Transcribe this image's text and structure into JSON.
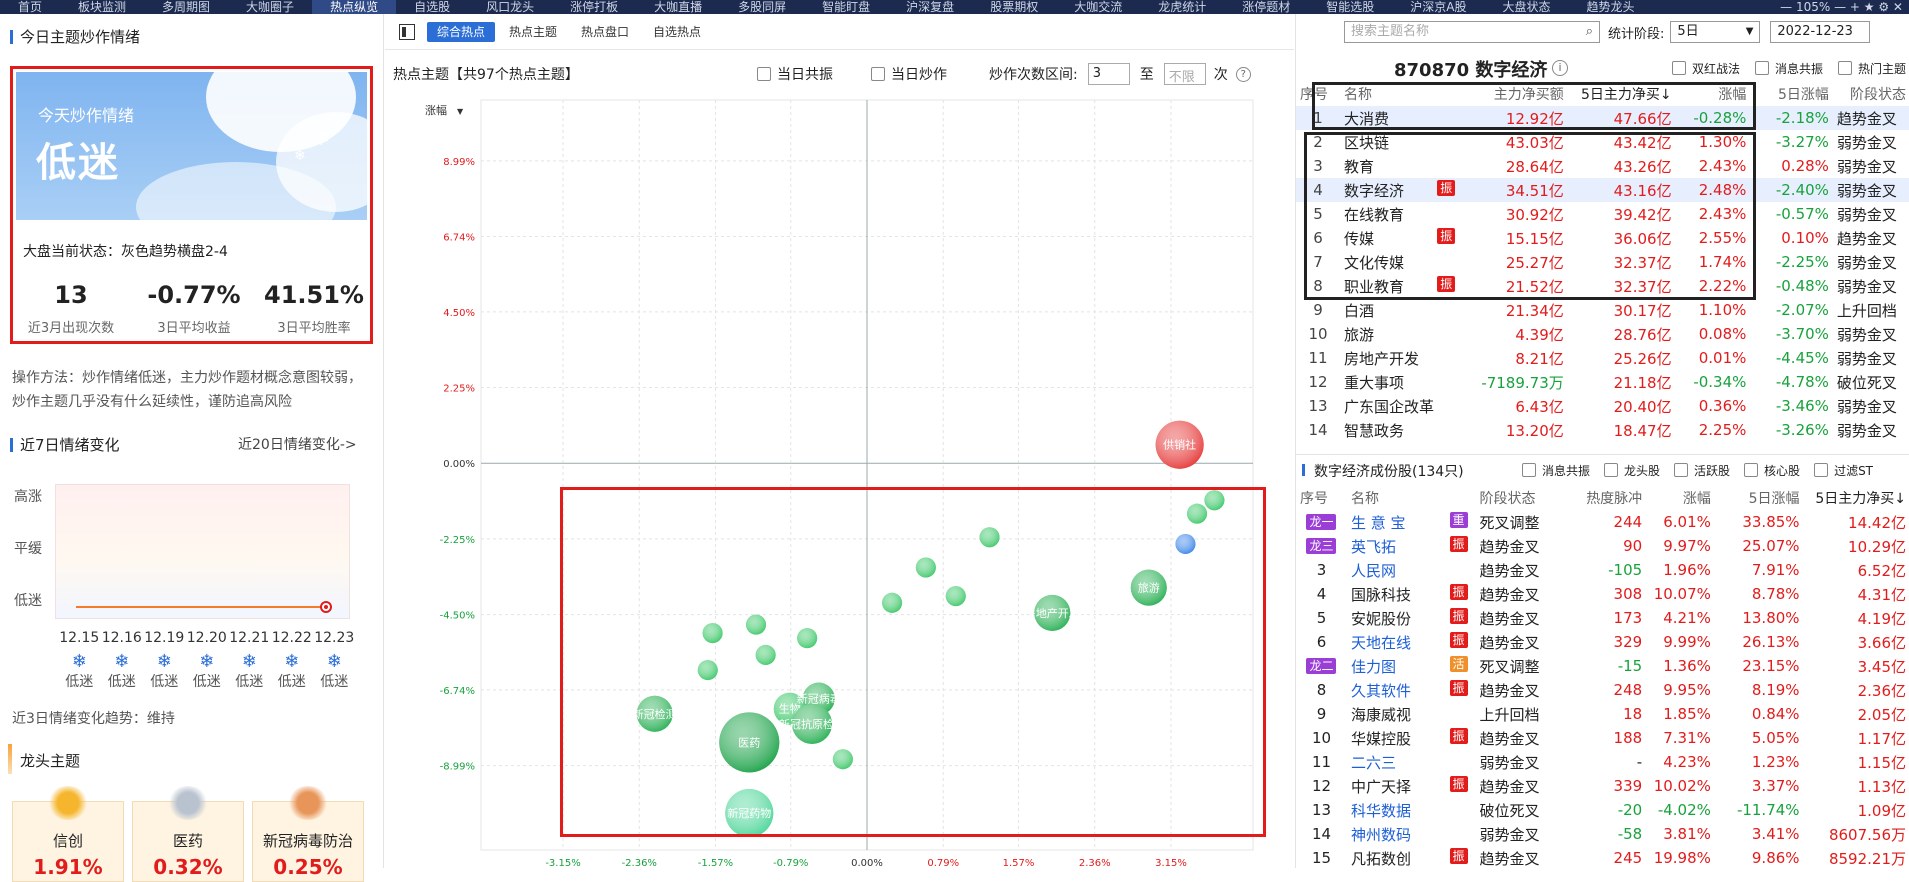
{
  "topnav": {
    "tabs": [
      "首页",
      "板块监测",
      "多周期图",
      "大咖圈子",
      "热点纵览",
      "自选股",
      "风口龙头",
      "涨停打板",
      "大咖直播",
      "多股同屏",
      "智能盯盘",
      "沪深复盘",
      "股票期权",
      "大咖交流",
      "龙虎统计",
      "涨停题材",
      "智能选股",
      "沪深京A股",
      "大盘状态",
      "趋势龙头"
    ],
    "active_index": 4,
    "controls": "— 105% — + ★ ⚙ ✕"
  },
  "left": {
    "mood_title": "今日主题炒作情绪",
    "sky_label": "今天炒作情绪",
    "sky_mood": "低迷",
    "market_status": "大盘当前状态：灰色趋势横盘2-4",
    "stats": [
      {
        "value": "13",
        "label": "近3月出现次数"
      },
      {
        "value": "-0.77%",
        "label": "3日平均收益"
      },
      {
        "value": "41.51%",
        "label": "3日平均胜率"
      }
    ],
    "method_text": "操作方法：炒作情绪低迷，主力炒作题材概念意图较弱，炒作主题几乎没有什么延续性，谨防追高风险",
    "week_title": "近7日情绪变化",
    "week_link": "近20日情绪变化->",
    "levels": [
      "高涨",
      "平缓",
      "低迷"
    ],
    "week_dates": [
      "12.15",
      "12.16",
      "12.19",
      "12.20",
      "12.21",
      "12.22",
      "12.23"
    ],
    "week_moods": [
      "低迷",
      "低迷",
      "低迷",
      "低迷",
      "低迷",
      "低迷",
      "低迷"
    ],
    "trend_text": "近3日情绪变化趋势：维持",
    "dragon_title": "龙头主题",
    "dragons": [
      {
        "name": "信创",
        "pct": "1.91%",
        "color": "#f5b62e"
      },
      {
        "name": "医药",
        "pct": "0.32%",
        "color": "#b9c2cf"
      },
      {
        "name": "新冠病毒防治",
        "pct": "0.25%",
        "color": "#e8955a"
      }
    ]
  },
  "mid": {
    "subtabs": [
      "综合热点",
      "热点主题",
      "热点盘口",
      "自选热点"
    ],
    "active_subtab": 0,
    "heading": "热点主题【共97个热点主题】",
    "opt_resonance": "当日共振",
    "opt_hype": "当日炒作",
    "range_label": "炒作次数区间:",
    "range_from": "3",
    "range_to_label": "至",
    "range_to_placeholder": "不限",
    "range_unit": "次"
  },
  "chart_data": {
    "type": "scatter",
    "ylabel": "涨幅",
    "y_ticks": [
      "8.99%",
      "6.74%",
      "4.50%",
      "2.25%",
      "0.00%",
      "-2.25%",
      "-4.50%",
      "-6.74%",
      "-8.99%"
    ],
    "x_ticks": [
      "-3.15%",
      "-2.36%",
      "-1.57%",
      "-0.79%",
      "0.00%",
      "0.79%",
      "1.57%",
      "2.36%",
      "3.15%"
    ],
    "ylim": [
      -11.5,
      10.8
    ],
    "xlim": [
      -4.0,
      4.0
    ],
    "points": [
      {
        "x": 3.24,
        "y": 0.55,
        "size": 24,
        "label": "供销社",
        "color": "#e63b3b"
      },
      {
        "x": 3.6,
        "y": -1.1,
        "size": 10,
        "label": "",
        "color": "#3ec86a"
      },
      {
        "x": 3.42,
        "y": -1.5,
        "size": 10,
        "label": "",
        "color": "#3ec86a"
      },
      {
        "x": 3.3,
        "y": -2.4,
        "size": 10,
        "label": "",
        "color": "#3b86e8"
      },
      {
        "x": 2.92,
        "y": -3.7,
        "size": 18,
        "label": "旅游",
        "color": "#2ab055"
      },
      {
        "x": 1.92,
        "y": -4.45,
        "size": 18,
        "label": "房地产开发",
        "color": "#2ab055"
      },
      {
        "x": 1.27,
        "y": -2.2,
        "size": 10,
        "label": "",
        "color": "#3ec86a"
      },
      {
        "x": 0.61,
        "y": -3.1,
        "size": 10,
        "label": "",
        "color": "#3ec86a"
      },
      {
        "x": 0.92,
        "y": -3.95,
        "size": 10,
        "label": "",
        "color": "#3ec86a"
      },
      {
        "x": 0.26,
        "y": -4.15,
        "size": 10,
        "label": "",
        "color": "#3ec86a"
      },
      {
        "x": -0.62,
        "y": -5.2,
        "size": 10,
        "label": "",
        "color": "#3ec86a"
      },
      {
        "x": -1.15,
        "y": -4.8,
        "size": 10,
        "label": "",
        "color": "#3ec86a"
      },
      {
        "x": -1.05,
        "y": -5.7,
        "size": 10,
        "label": "",
        "color": "#3ec86a"
      },
      {
        "x": -1.6,
        "y": -5.05,
        "size": 10,
        "label": "",
        "color": "#3ec86a"
      },
      {
        "x": -1.65,
        "y": -6.15,
        "size": 10,
        "label": "",
        "color": "#3ec86a"
      },
      {
        "x": -2.2,
        "y": -7.45,
        "size": 18,
        "label": "新冠检测",
        "color": "#2ab055"
      },
      {
        "x": -1.22,
        "y": -8.3,
        "size": 30,
        "label": "医药",
        "color": "#1ea34a"
      },
      {
        "x": -0.8,
        "y": -7.3,
        "size": 16,
        "label": "生物",
        "color": "#3ec86a"
      },
      {
        "x": -0.5,
        "y": -7.0,
        "size": 16,
        "label": "新冠病毒",
        "color": "#2ab055"
      },
      {
        "x": -0.57,
        "y": -7.75,
        "size": 20,
        "label": "新冠抗原检测",
        "color": "#2ab055"
      },
      {
        "x": -0.25,
        "y": -8.8,
        "size": 10,
        "label": "",
        "color": "#3ec86a"
      },
      {
        "x": -1.22,
        "y": -10.4,
        "size": 24,
        "label": "新冠药物",
        "color": "#4fd69a"
      }
    ]
  },
  "right": {
    "stage_label": "统计阶段:",
    "stage_value": "5日",
    "date_value": "2022-12-23",
    "search_placeholder": "搜索主题名称",
    "stock_title": "870870 数字经济",
    "opt1": "双红战法",
    "opt2": "消息共振",
    "opt3": "热门主题",
    "theme_headers": [
      "序号",
      "名称",
      "主力净买额",
      "5日主力净买↓",
      "涨幅",
      "5日涨幅",
      "阶段状态"
    ],
    "themes": [
      {
        "no": "1",
        "name": "大消费",
        "tag": "",
        "net": "12.92亿",
        "net5": "47.66亿",
        "chg": "-0.28%",
        "chg5": "-2.18%",
        "stage": "趋势金叉"
      },
      {
        "no": "2",
        "name": "区块链",
        "tag": "",
        "net": "43.03亿",
        "net5": "43.42亿",
        "chg": "1.30%",
        "chg5": "-3.27%",
        "stage": "弱势金叉"
      },
      {
        "no": "3",
        "name": "教育",
        "tag": "",
        "net": "28.64亿",
        "net5": "43.26亿",
        "chg": "2.43%",
        "chg5": "0.28%",
        "stage": "弱势金叉"
      },
      {
        "no": "4",
        "name": "数字经济",
        "tag": "振",
        "net": "34.51亿",
        "net5": "43.16亿",
        "chg": "2.48%",
        "chg5": "-2.40%",
        "stage": "弱势金叉"
      },
      {
        "no": "5",
        "name": "在线教育",
        "tag": "",
        "net": "30.92亿",
        "net5": "39.42亿",
        "chg": "2.43%",
        "chg5": "-0.57%",
        "stage": "弱势金叉"
      },
      {
        "no": "6",
        "name": "传媒",
        "tag": "振",
        "net": "15.15亿",
        "net5": "36.06亿",
        "chg": "2.55%",
        "chg5": "0.10%",
        "stage": "趋势金叉"
      },
      {
        "no": "7",
        "name": "文化传媒",
        "tag": "",
        "net": "25.27亿",
        "net5": "32.37亿",
        "chg": "1.74%",
        "chg5": "-2.25%",
        "stage": "弱势金叉"
      },
      {
        "no": "8",
        "name": "职业教育",
        "tag": "振",
        "net": "21.52亿",
        "net5": "32.37亿",
        "chg": "2.22%",
        "chg5": "-0.48%",
        "stage": "弱势金叉"
      },
      {
        "no": "9",
        "name": "白酒",
        "tag": "",
        "net": "21.34亿",
        "net5": "30.17亿",
        "chg": "1.10%",
        "chg5": "-2.07%",
        "stage": "上升回档"
      },
      {
        "no": "10",
        "name": "旅游",
        "tag": "",
        "net": "4.39亿",
        "net5": "28.76亿",
        "chg": "0.08%",
        "chg5": "-3.70%",
        "stage": "弱势金叉"
      },
      {
        "no": "11",
        "name": "房地产开发",
        "tag": "",
        "net": "8.21亿",
        "net5": "25.26亿",
        "chg": "0.01%",
        "chg5": "-4.45%",
        "stage": "弱势金叉"
      },
      {
        "no": "12",
        "name": "重大事项",
        "tag": "",
        "net": "-7189.73万",
        "net5": "21.18亿",
        "chg": "-0.34%",
        "chg5": "-4.78%",
        "stage": "破位死叉"
      },
      {
        "no": "13",
        "name": "广东国企改革",
        "tag": "",
        "net": "6.43亿",
        "net5": "20.40亿",
        "chg": "0.36%",
        "chg5": "-3.46%",
        "stage": "弱势金叉"
      },
      {
        "no": "14",
        "name": "智慧政务",
        "tag": "",
        "net": "13.20亿",
        "net5": "18.47亿",
        "chg": "2.25%",
        "chg5": "-3.26%",
        "stage": "弱势金叉"
      }
    ],
    "comp_title": "数字经济成份股(134只)",
    "comp_opts": [
      "消息共振",
      "龙头股",
      "活跃股",
      "核心股",
      "过滤ST"
    ],
    "comp_headers": [
      "序号",
      "名称",
      "阶段状态",
      "热度脉冲",
      "涨幅",
      "5日涨幅",
      "5日主力净买↓"
    ],
    "comps": [
      {
        "no": "龙一",
        "name": "生 意 宝",
        "tag": "重",
        "stage": "死叉调整",
        "heat": "244",
        "chg": "6.01%",
        "chg5": "33.85%",
        "net5": "14.42亿"
      },
      {
        "no": "龙三",
        "name": "英飞拓",
        "tag": "振",
        "stage": "趋势金叉",
        "heat": "90",
        "chg": "9.97%",
        "chg5": "25.07%",
        "net5": "10.29亿"
      },
      {
        "no": "3",
        "name": "人民网",
        "tag": "",
        "stage": "趋势金叉",
        "heat": "-105",
        "chg": "1.96%",
        "chg5": "7.91%",
        "net5": "6.52亿"
      },
      {
        "no": "4",
        "name": "国脉科技",
        "tag": "振",
        "stage": "趋势金叉",
        "heat": "308",
        "chg": "10.07%",
        "chg5": "8.78%",
        "net5": "4.31亿"
      },
      {
        "no": "5",
        "name": "安妮股份",
        "tag": "振",
        "stage": "趋势金叉",
        "heat": "173",
        "chg": "4.21%",
        "chg5": "13.80%",
        "net5": "4.19亿"
      },
      {
        "no": "6",
        "name": "天地在线",
        "tag": "振",
        "stage": "趋势金叉",
        "heat": "329",
        "chg": "9.99%",
        "chg5": "26.13%",
        "net5": "3.66亿"
      },
      {
        "no": "龙二",
        "name": "佳力图",
        "tag": "活",
        "stage": "死叉调整",
        "heat": "-15",
        "chg": "1.36%",
        "chg5": "23.15%",
        "net5": "3.45亿"
      },
      {
        "no": "8",
        "name": "久其软件",
        "tag": "振",
        "stage": "趋势金叉",
        "heat": "248",
        "chg": "9.95%",
        "chg5": "8.19%",
        "net5": "2.36亿"
      },
      {
        "no": "9",
        "name": "海康威视",
        "tag": "",
        "stage": "上升回档",
        "heat": "18",
        "chg": "1.85%",
        "chg5": "0.84%",
        "net5": "2.05亿"
      },
      {
        "no": "10",
        "name": "华媒控股",
        "tag": "振",
        "stage": "趋势金叉",
        "heat": "188",
        "chg": "7.31%",
        "chg5": "5.05%",
        "net5": "1.17亿"
      },
      {
        "no": "11",
        "name": "二六三",
        "tag": "",
        "stage": "弱势金叉",
        "heat": "-",
        "chg": "4.23%",
        "chg5": "1.23%",
        "net5": "1.15亿"
      },
      {
        "no": "12",
        "name": "中广天择",
        "tag": "振",
        "stage": "趋势金叉",
        "heat": "339",
        "chg": "10.02%",
        "chg5": "3.37%",
        "net5": "1.13亿"
      },
      {
        "no": "13",
        "name": "科华数据",
        "tag": "",
        "stage": "破位死叉",
        "heat": "-20",
        "chg": "-4.02%",
        "chg5": "-11.74%",
        "net5": "1.09亿"
      },
      {
        "no": "14",
        "name": "神州数码",
        "tag": "",
        "stage": "弱势金叉",
        "heat": "-58",
        "chg": "3.81%",
        "chg5": "3.41%",
        "net5": "8607.56万"
      },
      {
        "no": "15",
        "name": "凡拓数创",
        "tag": "振",
        "stage": "趋势金叉",
        "heat": "245",
        "chg": "19.98%",
        "chg5": "9.86%",
        "net5": "8592.21万"
      }
    ]
  }
}
